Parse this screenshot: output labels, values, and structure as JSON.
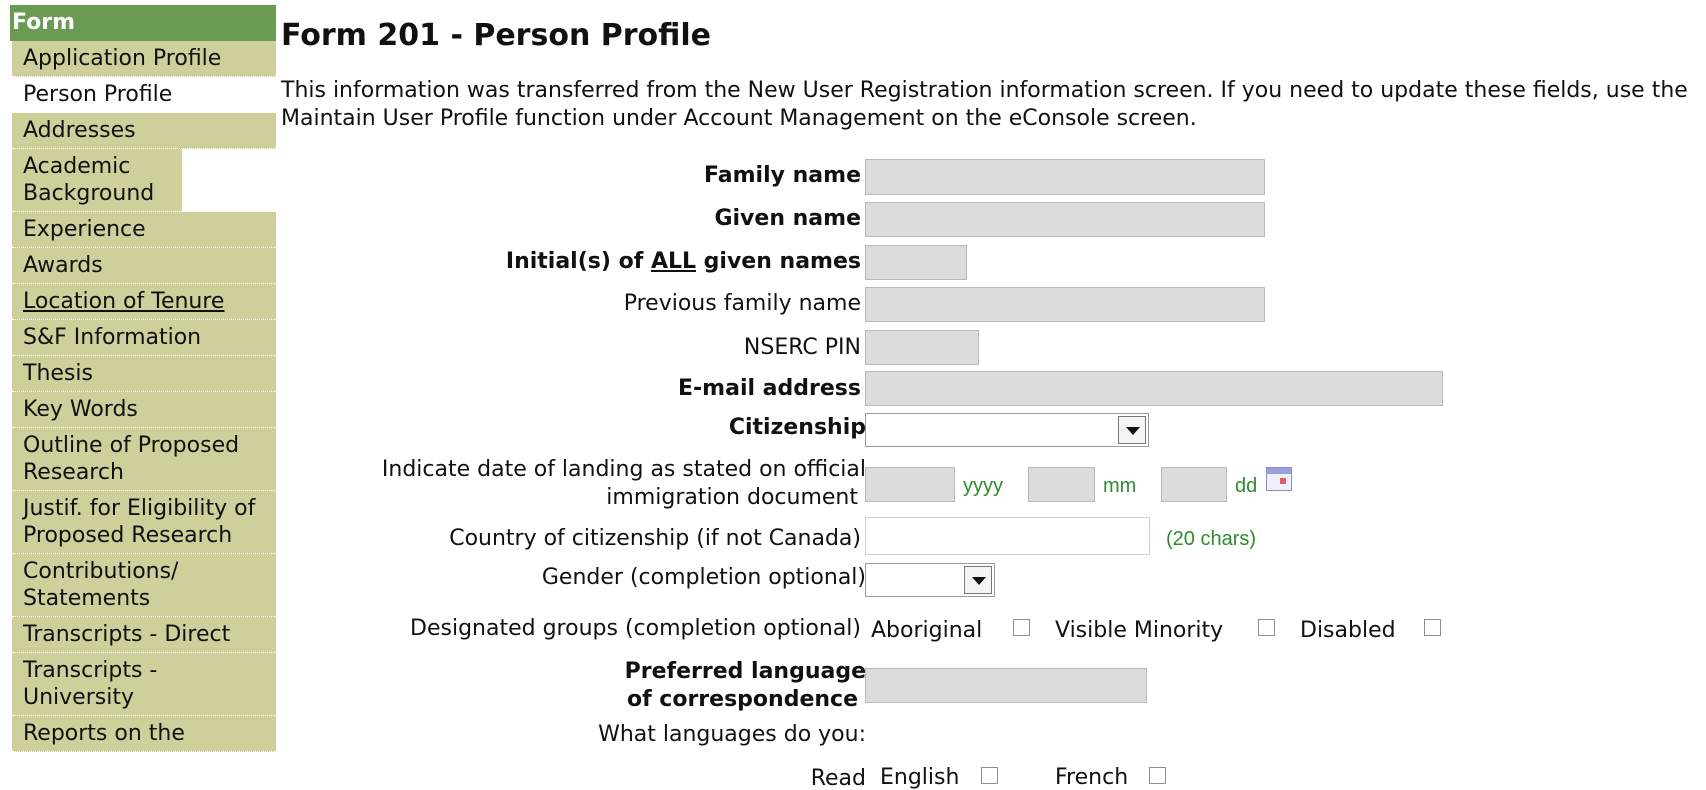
{
  "sidebar": {
    "header": "Form",
    "items": [
      {
        "label": "Application Profile"
      },
      {
        "label": "Person Profile"
      },
      {
        "label": "Addresses"
      },
      {
        "label": "Academic Background"
      },
      {
        "label": "Experience"
      },
      {
        "label": "Awards"
      },
      {
        "label": "Location of Tenure"
      },
      {
        "label": "S&F Information"
      },
      {
        "label": "Thesis"
      },
      {
        "label": "Key Words"
      },
      {
        "label": "Outline of Proposed Research"
      },
      {
        "label": "Justif. for Eligibility of Proposed Research"
      },
      {
        "label": "Contributions/ Statements"
      },
      {
        "label": "Transcripts - Direct"
      },
      {
        "label": "Transcripts - University"
      },
      {
        "label": "Reports on the"
      }
    ],
    "active_item": "Person Profile"
  },
  "main": {
    "title": "Form 201 - Person Profile",
    "intro": "This information was transferred from the New User Registration information screen. If you need to update these fields, use the Maintain User Profile function under Account Management on the eConsole screen."
  },
  "form": {
    "family_name": {
      "label": "Family name",
      "value": ""
    },
    "given_name": {
      "label": "Given name",
      "value": ""
    },
    "initials": {
      "label_pre": "Initial(s) of ",
      "label_em": "ALL",
      "label_post": " given names",
      "value": ""
    },
    "previous_family_name": {
      "label": "Previous family name",
      "value": ""
    },
    "nserc_pin": {
      "label": "NSERC PIN",
      "value": ""
    },
    "email": {
      "label": "E-mail address",
      "value": ""
    },
    "citizenship": {
      "label": "Citizenship",
      "selected": ""
    },
    "landing_date": {
      "label_line1": "Indicate date of landing as stated on official",
      "label_line2": "immigration document",
      "yyyy_hint": "yyyy",
      "mm_hint": "mm",
      "dd_hint": "dd",
      "yyyy": "",
      "mm": "",
      "dd": ""
    },
    "country_of_citizenship": {
      "label": "Country of citizenship (if not Canada)",
      "value": "",
      "hint": "(20 chars)"
    },
    "gender": {
      "label": "Gender (completion optional)",
      "selected": ""
    },
    "designated_groups": {
      "label": "Designated groups (completion optional)",
      "options": [
        "Aboriginal",
        "Visible Minority",
        "Disabled"
      ],
      "checked": [
        false,
        false,
        false
      ]
    },
    "preferred_language": {
      "label_line1": "Preferred language",
      "label_line2": "of correspondence",
      "value": ""
    },
    "languages_question": "What languages do you:",
    "read": {
      "label": "Read",
      "options": [
        "English",
        "French"
      ],
      "checked": [
        false,
        false
      ]
    }
  },
  "icons": {
    "calendar": "calendar-icon",
    "dropdown": "chevron-down-icon",
    "checkbox": "checkbox-icon"
  },
  "colors": {
    "sidebar_header": "#6b9a53",
    "sidebar_item": "#cfcf9b",
    "hint_text": "#2e8b2e",
    "readonly_field": "#dcdcdc"
  }
}
